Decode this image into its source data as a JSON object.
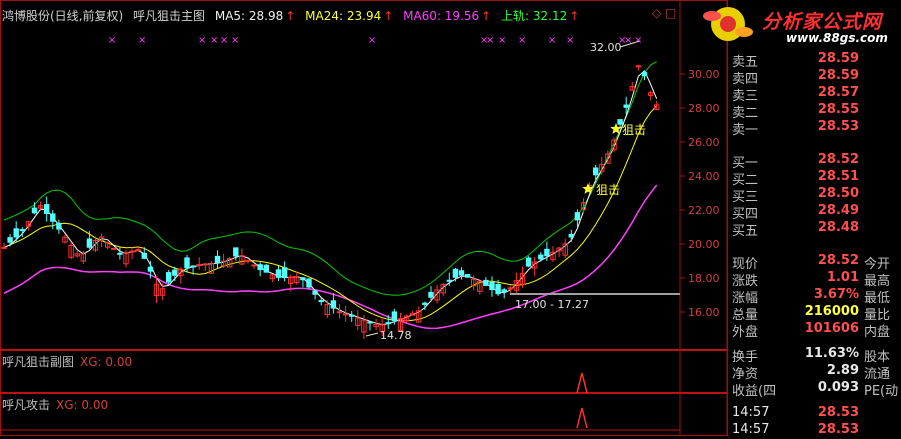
{
  "header": {
    "stock": "鸿博股份(日线,前复权)",
    "indicator": "呼凡狙击主图",
    "ma5_label": "MA5: 28.98",
    "ma24_label": "MA24: 23.94",
    "ma60_label": "MA60: 19.56",
    "upper_label": "上轨: 32.12",
    "up_arrow": "↑",
    "right_icons": "◇ □"
  },
  "main_chart": {
    "y_ticks": [
      "30.00",
      "28.00",
      "26.00",
      "24.00",
      "22.00",
      "20.00",
      "18.00",
      "16.00"
    ],
    "high_label": "32.00",
    "low_label": "14.78",
    "range_label": "17.00 - 17.27",
    "signal_label_1": "狙击",
    "signal_label_2": "狙击",
    "colors": {
      "up": "#ff3232",
      "down": "#54ffff",
      "ma5": "#ffffff",
      "ma24": "#ffff00",
      "ma60": "#ff40ff",
      "upper": "#00cc00",
      "price_line": "#a0a0a0"
    }
  },
  "sub_chart_1": {
    "title": "呼凡狙击副图",
    "xg": "XG: 0.00"
  },
  "sub_chart_2": {
    "title": "呼凡攻击",
    "xg": "XG: 0.00"
  },
  "logo": {
    "text": "分析家公式网",
    "url": "www.88gs.com"
  },
  "quote_panel": {
    "asks": [
      {
        "label": "卖五",
        "price": "28.59",
        "vol": ""
      },
      {
        "label": "卖四",
        "price": "28.59",
        "vol": ""
      },
      {
        "label": "卖三",
        "price": "28.57",
        "vol": ""
      },
      {
        "label": "卖二",
        "price": "28.55",
        "vol": ""
      },
      {
        "label": "卖一",
        "price": "28.53",
        "vol": ""
      }
    ],
    "bids": [
      {
        "label": "买一",
        "price": "28.52"
      },
      {
        "label": "买二",
        "price": "28.51"
      },
      {
        "label": "买三",
        "price": "28.50"
      },
      {
        "label": "买四",
        "price": "28.49"
      },
      {
        "label": "买五",
        "price": "28.48"
      }
    ],
    "stats": [
      {
        "label": "现价",
        "value": "28.52",
        "label2": "今开"
      },
      {
        "label": "涨跌",
        "value": "1.01",
        "label2": "最高"
      },
      {
        "label": "涨幅",
        "value": "3.67%",
        "label2": "最低"
      },
      {
        "label": "总量",
        "value": "216000",
        "label2": "量比"
      },
      {
        "label": "外盘",
        "value": "101606",
        "label2": "内盘"
      }
    ],
    "stats2": [
      {
        "label": "换手",
        "value": "11.63%",
        "label2": "股本"
      },
      {
        "label": "净资",
        "value": "2.89",
        "label2": "流通"
      },
      {
        "label": "收益(四",
        "value": "0.093",
        "label2": "PE(动"
      }
    ],
    "ticks": [
      {
        "time": "14:57",
        "price": "28.53"
      },
      {
        "time": "14:57",
        "price": "28.53"
      }
    ]
  }
}
